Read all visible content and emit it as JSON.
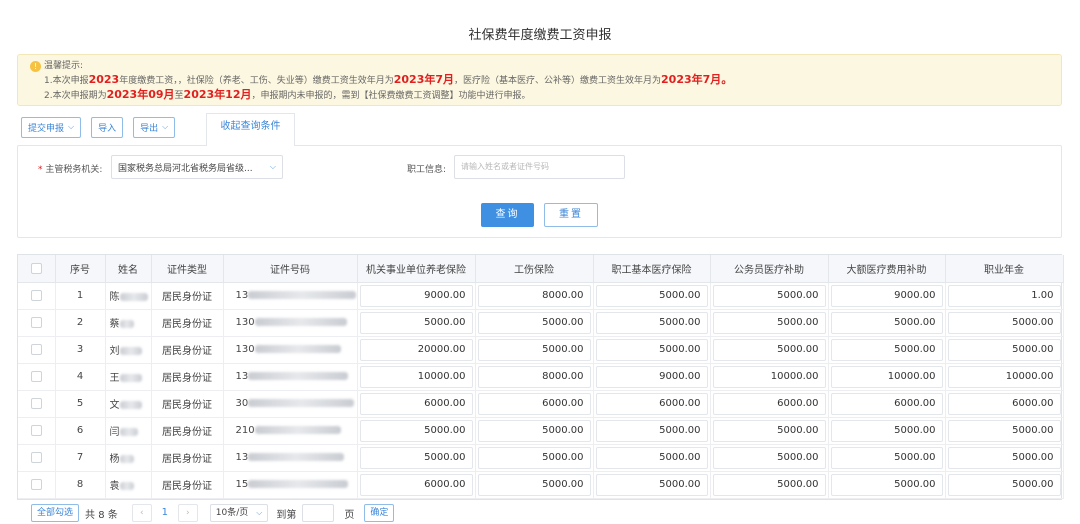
{
  "page": {
    "title": "社保费年度缴费工资申报"
  },
  "notice": {
    "header": "温馨提示:",
    "line1": {
      "a": "1.本次申报",
      "year": "2023",
      "b": "年度缴费工资，，社保险（养老、工伤、失业等）缴费工资生效年月为",
      "eff1": "2023年7月",
      "c": "，医疗险（基本医疗、公补等）缴费工资生效年月为",
      "eff2": "2023年7月",
      "d": "。"
    },
    "line2": {
      "a": "2.本次申报期为",
      "start": "2023年09月",
      "b": "至",
      "end": "2023年12月",
      "c": "，申报期内未申报的，需到【社保费缴费工资调整】功能中进行申报。"
    }
  },
  "toolbar": {
    "submit_label": "提交申报",
    "import_label": "导入",
    "export_label": "导出",
    "collapse_tab": "收起查询条件"
  },
  "query": {
    "authority_label": "主管税务机关:",
    "authority_value": "国家税务总局河北省税务局省级...",
    "employee_label": "职工信息:",
    "employee_placeholder": "请输入姓名或者证件号码",
    "search_label": "查询",
    "reset_label": "重置"
  },
  "table": {
    "headers": [
      "序号",
      "姓名",
      "证件类型",
      "证件号码",
      "机关事业单位养老保险",
      "工伤保险",
      "职工基本医疗保险",
      "公务员医疗补助",
      "大额医疗费用补助",
      "职业年金"
    ],
    "rows": [
      {
        "no": "1",
        "name": "陈",
        "type": "居民身份证",
        "id": "13",
        "v": [
          "9000.00",
          "8000.00",
          "5000.00",
          "5000.00",
          "9000.00",
          "1.00"
        ]
      },
      {
        "no": "2",
        "name": "蔡",
        "type": "居民身份证",
        "id": "130",
        "v": [
          "5000.00",
          "5000.00",
          "5000.00",
          "5000.00",
          "5000.00",
          "5000.00"
        ]
      },
      {
        "no": "3",
        "name": "刘",
        "type": "居民身份证",
        "id": "130",
        "v": [
          "20000.00",
          "5000.00",
          "5000.00",
          "5000.00",
          "5000.00",
          "5000.00"
        ]
      },
      {
        "no": "4",
        "name": "王",
        "type": "居民身份证",
        "id": "13",
        "v": [
          "10000.00",
          "8000.00",
          "9000.00",
          "10000.00",
          "10000.00",
          "10000.00"
        ]
      },
      {
        "no": "5",
        "name": "文",
        "type": "居民身份证",
        "id": "30",
        "v": [
          "6000.00",
          "6000.00",
          "6000.00",
          "6000.00",
          "6000.00",
          "6000.00"
        ]
      },
      {
        "no": "6",
        "name": "闫",
        "type": "居民身份证",
        "id": "210",
        "v": [
          "5000.00",
          "5000.00",
          "5000.00",
          "5000.00",
          "5000.00",
          "5000.00"
        ]
      },
      {
        "no": "7",
        "name": "杨",
        "type": "居民身份证",
        "id": "13",
        "v": [
          "5000.00",
          "5000.00",
          "5000.00",
          "5000.00",
          "5000.00",
          "5000.00"
        ]
      },
      {
        "no": "8",
        "name": "袁",
        "type": "居民身份证",
        "id": "15",
        "v": [
          "6000.00",
          "5000.00",
          "5000.00",
          "5000.00",
          "5000.00",
          "5000.00"
        ]
      }
    ]
  },
  "pager": {
    "select_all_label": "全部勾选",
    "total_text": "共 8 条",
    "prev": "‹",
    "current_page": "1",
    "next": "›",
    "page_size": "10条/页",
    "goto_label": "到第",
    "page_unit": "页",
    "confirm_label": "确定"
  }
}
